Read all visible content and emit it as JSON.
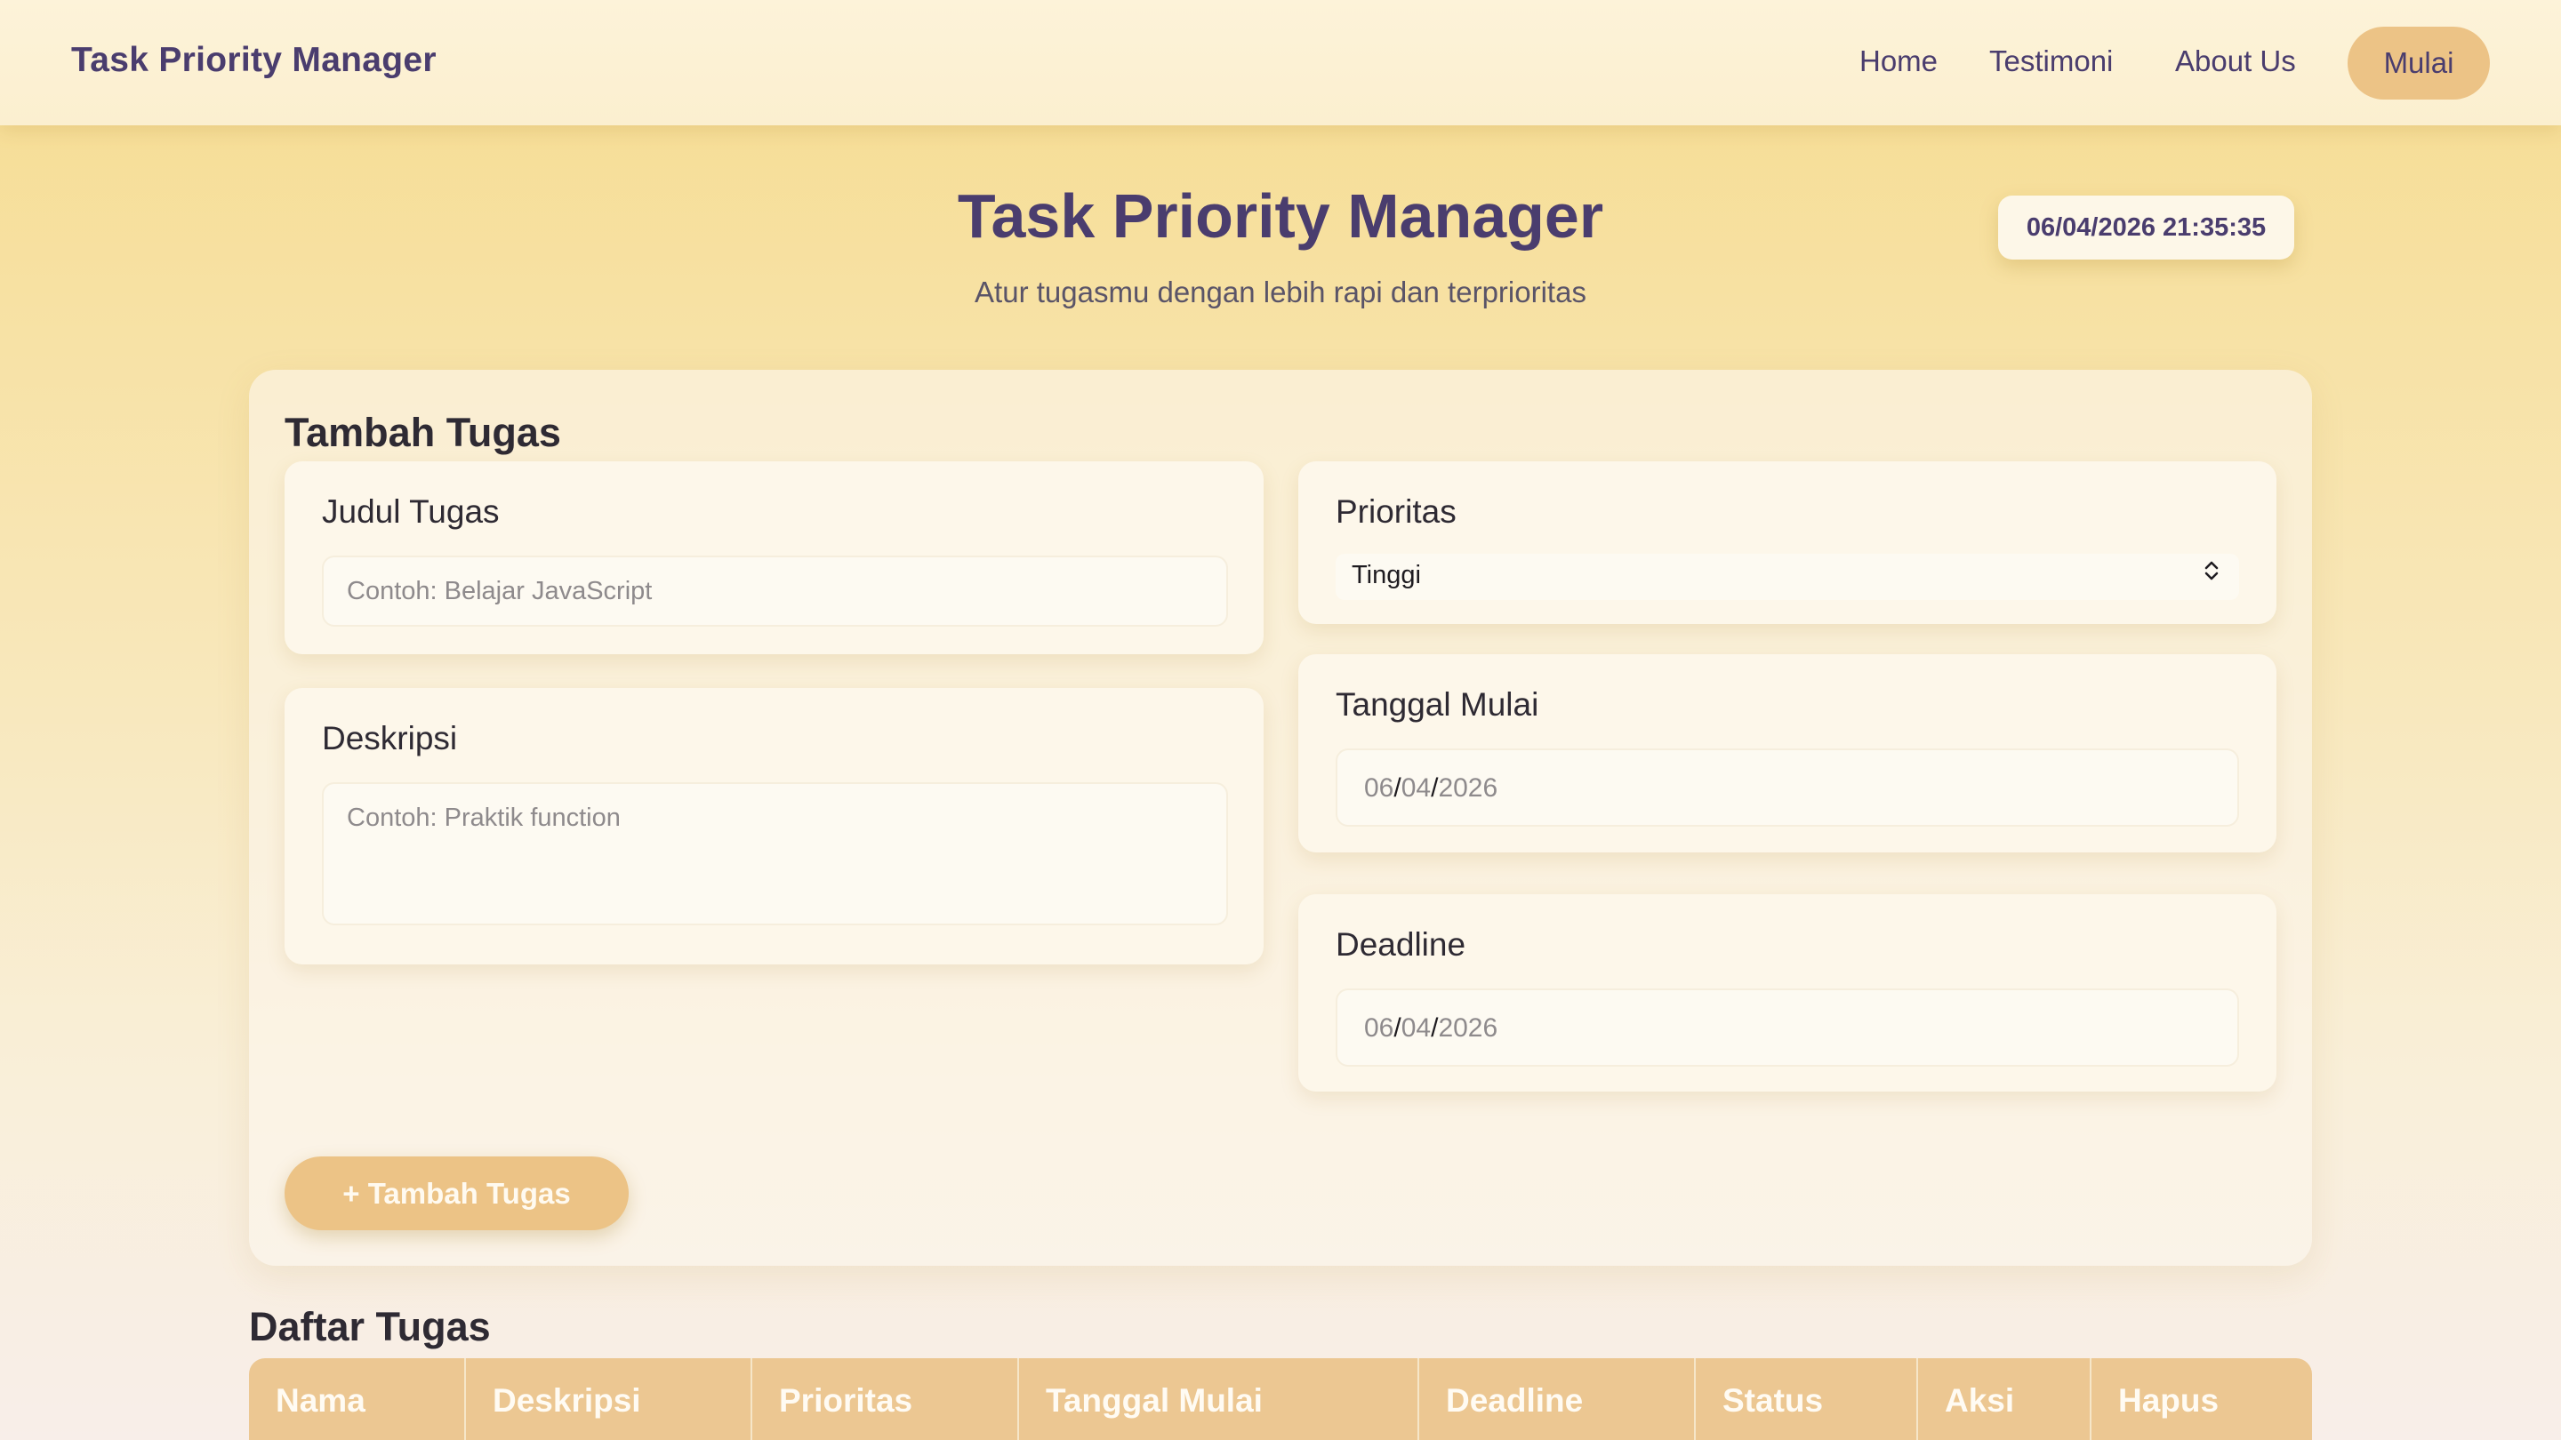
{
  "navbar": {
    "brand": "Task Priority Manager",
    "links": {
      "home": "Home",
      "testimoni": "Testimoni",
      "about": "About Us"
    },
    "cta": "Mulai"
  },
  "hero": {
    "title": "Task Priority Manager",
    "subtitle": "Atur tugasmu dengan lebih rapi dan terprioritas",
    "clock": "06/04/2026 21:35:35"
  },
  "form": {
    "title": "Tambah Tugas",
    "judul": {
      "label": "Judul Tugas",
      "placeholder": "Contoh: Belajar JavaScript"
    },
    "deskripsi": {
      "label": "Deskripsi",
      "placeholder": "Contoh: Praktik function"
    },
    "prioritas": {
      "label": "Prioritas",
      "selected": "Tinggi"
    },
    "tanggal_mulai": {
      "label": "Tanggal Mulai",
      "day": "06",
      "month": "04",
      "year": "2026"
    },
    "deadline": {
      "label": "Deadline",
      "day": "06",
      "month": "04",
      "year": "2026"
    },
    "submit": "+ Tambah Tugas"
  },
  "list": {
    "title": "Daftar Tugas",
    "columns": [
      "Nama",
      "Deskripsi",
      "Prioritas",
      "Tanggal Mulai",
      "Deadline",
      "Status",
      "Aksi",
      "Hapus"
    ]
  },
  "colors": {
    "accent": "#ecc386",
    "brand_text": "#4a3d6e",
    "table_header": "#ecc792"
  }
}
